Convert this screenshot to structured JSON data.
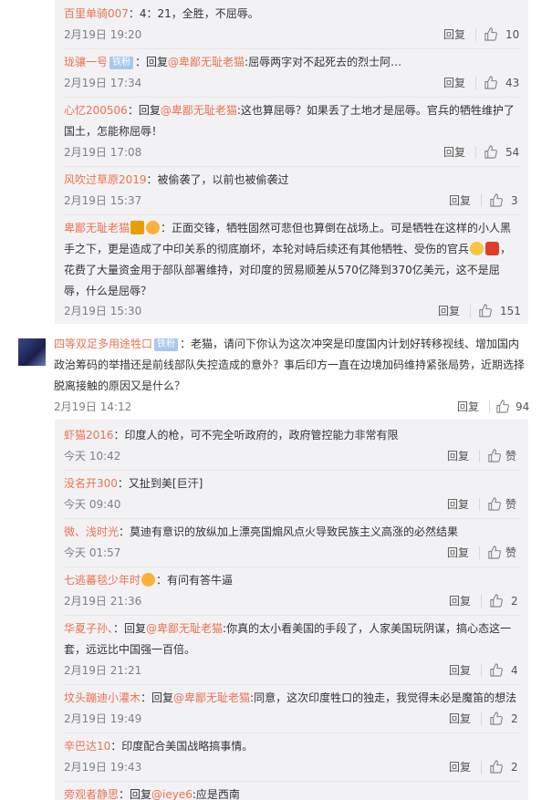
{
  "comments": [
    {
      "user": "百里单骑007",
      "text": "：4：21，全胜，不屈辱。",
      "time": "2月19日 19:20",
      "reply": "回复",
      "likes": "10"
    },
    {
      "user": "珑骧一号",
      "badge": "铁粉",
      "text_prefix": "：回复",
      "at": "@卑鄙无耻老猫",
      "text": ":屈辱两字对不起死去的烈士阿…",
      "time": "2月19日 17:34",
      "reply": "回复",
      "likes": "43"
    },
    {
      "user": "心忆200506",
      "text_prefix": "：回复",
      "at": "@卑鄙无耻老猫",
      "text": ":这也算屈辱？如果丢了土地才是屈辱。官兵的牺牲维护了",
      "text2": "国土，怎能称屈辱！",
      "time": "2月19日 17:08",
      "reply": "回复",
      "likes": "54"
    },
    {
      "user": "风吹过草原2019",
      "text": "：被偷袭了，以前也被偷袭过",
      "time": "2月19日 15:37",
      "reply": "回复",
      "likes": "3"
    },
    {
      "user": "卑鄙无耻老猫",
      "text": "：正面交锋，牺牲固然可悲但也算倒在战场上。可是牺牲在这样的小人黑",
      "text2": "手之下，更是造成了中印关系的彻底崩坏，本轮对峙后续还有其他牺牲、受伤的官兵",
      "text3": "花费了大量资金用于部队部署维持，对印度的贸易顺差从570亿降到370亿美元，这不是屈",
      "text4": "辱，什么是屈辱？",
      "time": "2月19日 15:30",
      "reply": "回复",
      "likes": "151"
    }
  ],
  "main_comment": {
    "user": "四等双足多用途牲口",
    "badge": "铁粉",
    "text": "：老猫，请问下你认为这次冲突是印度国内计划好转移视线、增加国内",
    "text2": "政治筹码的举措还是前线部队失控造成的意外？事后印方一直在边境加码维持紧张局势，近期选择",
    "text3": "脱离接触的原因又是什么？",
    "time": "2月19日 14:12",
    "reply": "回复",
    "likes": "94"
  },
  "replies": [
    {
      "user": "虾猫2016",
      "text": "：印度人的枪，可不完全听政府的，政府管控能力非常有限",
      "time": "今天 10:42",
      "reply": "回复",
      "likes": "赞"
    },
    {
      "user": "没名开300",
      "text": "：又扯到美[巨汗]",
      "time": "今天 09:40",
      "reply": "回复",
      "likes": "赞"
    },
    {
      "user": "微、浅时光",
      "text": "：莫迪有意识的放纵加上漂亮国煽风点火导致民族主义高涨的必然结果",
      "time": "今天 01:57",
      "reply": "回复",
      "likes": "赞"
    },
    {
      "user": "七逃蕃毯少年时",
      "text": "：有问有答牛逼",
      "time": "2月19日 21:36",
      "reply": "回复",
      "likes": "2"
    },
    {
      "user": "华夏子孙、",
      "text_prefix": "：回复",
      "at": "@卑鄙无耻老猫",
      "text": ":你真的太小看美国的手段了，人家美国玩阴谋，搞心态这一",
      "text2": "套，远远比中国强一百倍。",
      "time": "2月19日 21:21",
      "reply": "回复",
      "likes": "4"
    },
    {
      "user": "坟头蹦迪小灌木",
      "text_prefix": "：回复",
      "at": "@卑鄙无耻老猫",
      "text": ":同意，这次印度牲口的独走，我觉得未必是魔笛的想法",
      "time": "2月19日 19:49",
      "reply": "回复",
      "likes": "2"
    },
    {
      "user": "辛巴达10",
      "text": "：印度配合美国战略搞事情。",
      "time": "2月19日 19:43",
      "reply": "回复",
      "likes": "2"
    },
    {
      "user": "旁观者静思",
      "text_prefix": "：回复",
      "at": "@ieye6",
      "text": ":应是西南"
    }
  ],
  "colors": {
    "username": "#eb7350",
    "meta": "#808080",
    "reply_bg": "#f2f2f5",
    "badge": "#a6c8f0"
  },
  "icons": {
    "like": "thumbs-up-icon",
    "avatar": "avatar"
  }
}
